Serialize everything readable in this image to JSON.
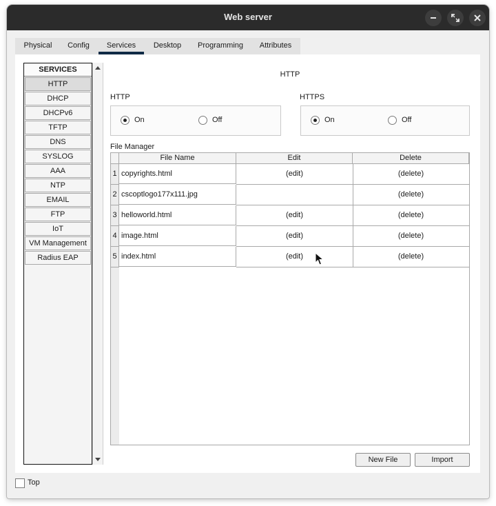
{
  "window": {
    "title": "Web server"
  },
  "tabs": [
    {
      "label": "Physical"
    },
    {
      "label": "Config"
    },
    {
      "label": "Services"
    },
    {
      "label": "Desktop"
    },
    {
      "label": "Programming"
    },
    {
      "label": "Attributes"
    }
  ],
  "services": {
    "header": "SERVICES",
    "items": [
      "HTTP",
      "DHCP",
      "DHCPv6",
      "TFTP",
      "DNS",
      "SYSLOG",
      "AAA",
      "NTP",
      "EMAIL",
      "FTP",
      "IoT",
      "VM Management",
      "Radius EAP"
    ],
    "selected": "HTTP"
  },
  "panel": {
    "title": "HTTP",
    "http": {
      "label": "HTTP",
      "on": "On",
      "off": "Off",
      "value": "On"
    },
    "https": {
      "label": "HTTPS",
      "on": "On",
      "off": "Off",
      "value": "On"
    },
    "file_manager": {
      "label": "File Manager",
      "columns": [
        "File Name",
        "Edit",
        "Delete"
      ],
      "rows": [
        {
          "num": "1",
          "name": "copyrights.html",
          "edit": "(edit)",
          "delete": "(delete)"
        },
        {
          "num": "2",
          "name": "cscoptlogo177x111.jpg",
          "edit": "",
          "delete": "(delete)"
        },
        {
          "num": "3",
          "name": "helloworld.html",
          "edit": "(edit)",
          "delete": "(delete)"
        },
        {
          "num": "4",
          "name": "image.html",
          "edit": "(edit)",
          "delete": "(delete)"
        },
        {
          "num": "5",
          "name": "index.html",
          "edit": "(edit)",
          "delete": "(delete)"
        }
      ]
    },
    "buttons": {
      "new_file": "New File",
      "import": "Import"
    }
  },
  "footer": {
    "top_label": "Top",
    "top_checked": false
  }
}
